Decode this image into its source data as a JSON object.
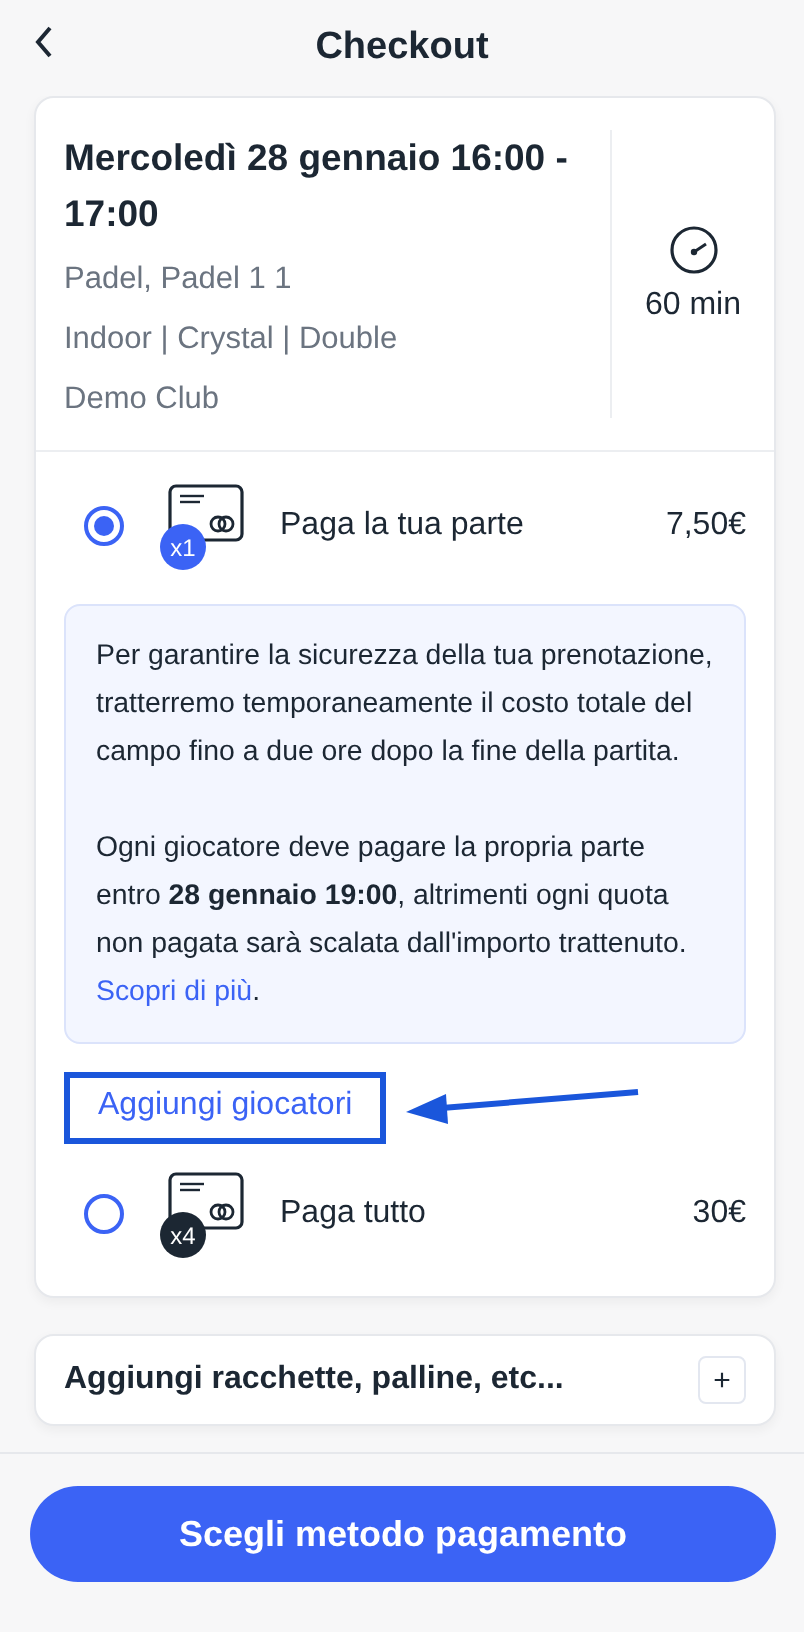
{
  "header": {
    "title": "Checkout"
  },
  "booking": {
    "title": "Mercoledì 28 gennaio 16:00 - 17:00",
    "details": [
      "Padel, Padel 1 1",
      "Indoor | Crystal | Double",
      "Demo Club"
    ],
    "duration": "60 min"
  },
  "payment_options": [
    {
      "label": "Paga la tua parte",
      "multiplier": "x1",
      "price": "7,50€",
      "selected": true,
      "info": {
        "paragraphs": [
          "Per garantire la sicurezza della tua prenotazione, tratterremo temporaneamente il costo totale del campo fino a due ore dopo la fine della partita."
        ],
        "note": "Ogni giocatore deve pagare la propria parte entro **28 gennaio 19:00**, altrimenti ogni quota non pagata sarà scalata dall'importo trattenuto.",
        "link": "Scopri di più",
        "after": "."
      },
      "action": {
        "label": "Aggiungi giocatori",
        "highlighted": true
      }
    },
    {
      "label": "Paga tutto",
      "multiplier": "x4",
      "price": "30€",
      "selected": false
    }
  ],
  "extras": {
    "label": "Aggiungi racchette, palline, etc...",
    "button": "+"
  },
  "footer": {
    "button": "Scegli metodo pagamento"
  }
}
